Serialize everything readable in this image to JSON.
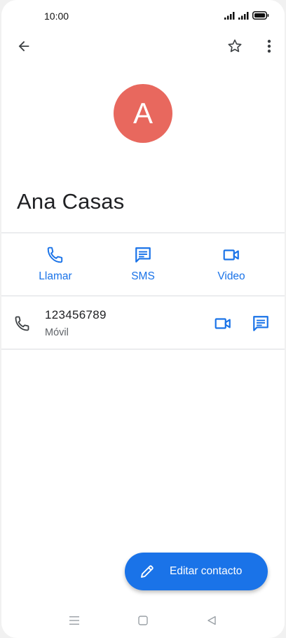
{
  "status": {
    "time": "10:00"
  },
  "contact": {
    "avatar_letter": "A",
    "name": "Ana Casas"
  },
  "actions": [
    {
      "label": "Llamar",
      "icon": "phone-icon"
    },
    {
      "label": "SMS",
      "icon": "message-icon"
    },
    {
      "label": "Video",
      "icon": "video-icon"
    }
  ],
  "phone": {
    "number": "123456789",
    "type": "Móvil"
  },
  "fab": {
    "label": "Editar contacto",
    "icon": "pencil-icon"
  },
  "colors": {
    "accent": "#1a73e8",
    "avatar": "#e8685e",
    "divider": "#dadce0"
  }
}
